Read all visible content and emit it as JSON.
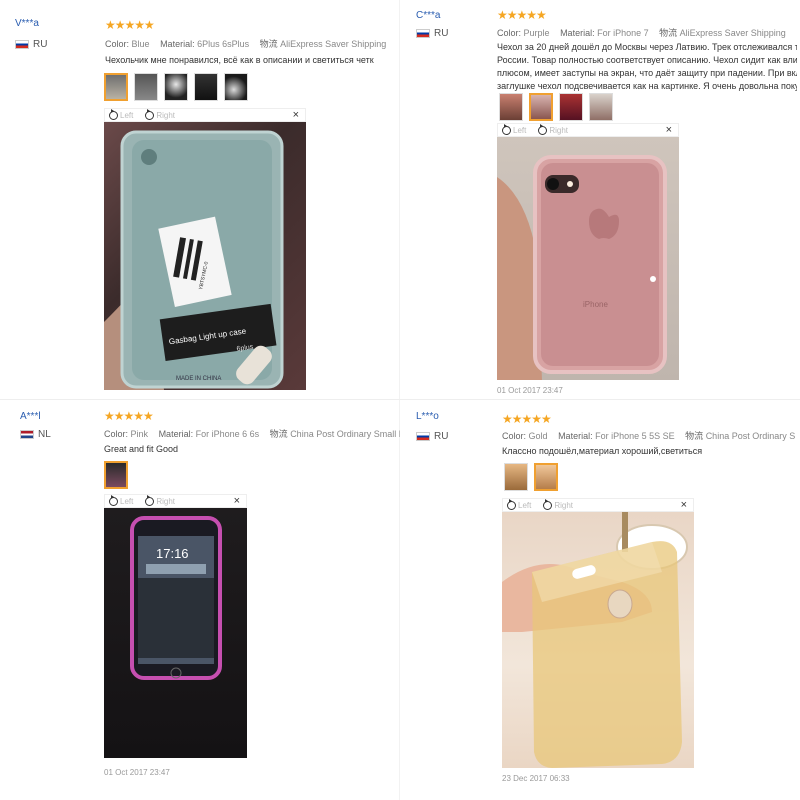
{
  "reviews": [
    {
      "user": "V***a",
      "country": "RU",
      "stars": "★★★★★",
      "color_label": "Color:",
      "color": "Blue",
      "material_label": "Material:",
      "material": "6Plus 6sPlus",
      "shipping_label": "物流",
      "shipping": "AliExpress Saver Shipping",
      "text": [
        "Чехольчик мне понравился, всё как в описании и светиться четк"
      ],
      "viewer_left": "Left",
      "viewer_right": "Right",
      "close": "×",
      "date": "",
      "photo_texts": {
        "brand": "Gasbag Light up case",
        "size": "6plus",
        "made_in": "MADE IN CHINA",
        "barcode": "YBTSYMC-0"
      }
    },
    {
      "user": "C***a",
      "country": "RU",
      "stars": "★★★★★",
      "color_label": "Color:",
      "color": "Purple",
      "material_label": "Material:",
      "material": "For iPhone 7",
      "shipping_label": "物流",
      "shipping": "AliExpress Saver Shipping",
      "text": [
        "Чехол за 20 дней дошёл до Москвы через Латвию. Трек отслеживался то",
        "России. Товар полностью соответствует описанию. Чехол сидит как вли",
        "плюсом, имеет заступы на экран, что даёт защиту при падении. При вкл",
        "заглушке чехол подсвечивается как на картинке. Я очень довольна поку"
      ],
      "viewer_left": "Left",
      "viewer_right": "Right",
      "close": "×",
      "date": "01 Oct 2017 23:47",
      "photo_texts": {
        "model": "iPhone"
      }
    },
    {
      "user": "A***l",
      "country": "NL",
      "stars": "★★★★★",
      "color_label": "Color:",
      "color": "Pink",
      "material_label": "Material:",
      "material": "For iPhone 6 6s",
      "shipping_label": "物流",
      "shipping": "China Post Ordinary Small F",
      "text": [
        "Great and fit Good"
      ],
      "viewer_left": "Left",
      "viewer_right": "Right",
      "close": "×",
      "date": "01 Oct 2017 23:47",
      "photo_texts": {
        "time": "17:16"
      }
    },
    {
      "user": "L***o",
      "country": "RU",
      "stars": "★★★★★",
      "color_label": "Color:",
      "color": "Gold",
      "material_label": "Material:",
      "material": "For iPhone 5 5S SE",
      "shipping_label": "物流",
      "shipping": "China Post Ordinary S",
      "text": [
        "Классно подошёл,материал хороший,светиться"
      ],
      "viewer_left": "Left",
      "viewer_right": "Right",
      "close": "×",
      "date": "23 Dec 2017 06:33"
    }
  ],
  "colors": {
    "stars": "#f5a623",
    "user": "#2a5db0",
    "thumb_selected": "#f0a030"
  }
}
